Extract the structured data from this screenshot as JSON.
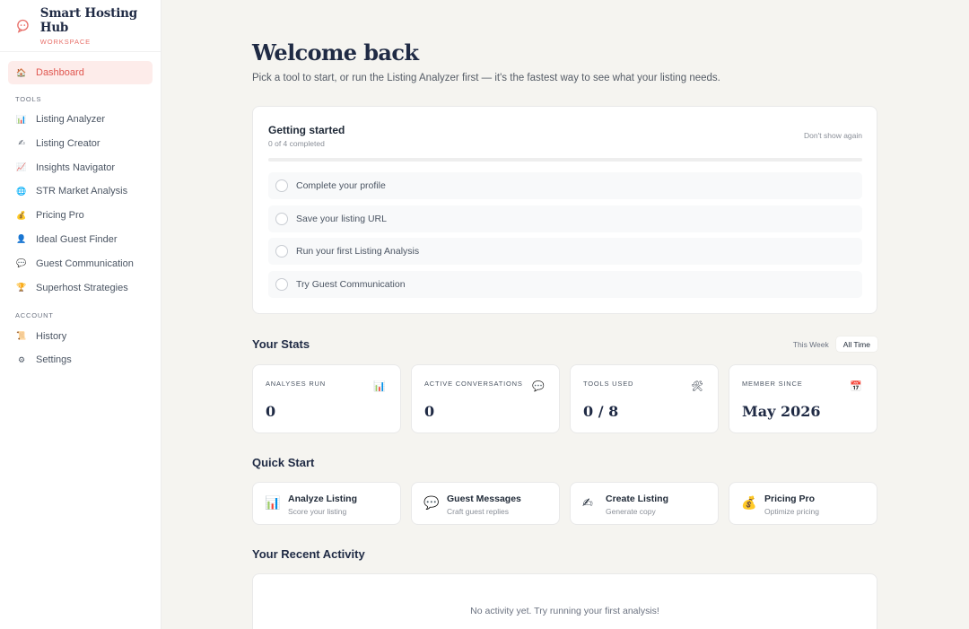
{
  "brand": {
    "name": "Smart Hosting Hub",
    "subtitle": "WORKSPACE",
    "accent": "#e0564f"
  },
  "sidebar": {
    "dashboard": {
      "label": "Dashboard",
      "icon": "house-icon"
    },
    "tools_heading": "TOOLS",
    "tools": [
      {
        "label": "Listing Analyzer",
        "icon": "bar-chart-icon"
      },
      {
        "label": "Listing Creator",
        "icon": "writing-hand-icon"
      },
      {
        "label": "Insights Navigator",
        "icon": "trend-chart-icon"
      },
      {
        "label": "STR Market Analysis",
        "icon": "globe-icon"
      },
      {
        "label": "Pricing Pro",
        "icon": "money-bag-icon"
      },
      {
        "label": "Ideal Guest Finder",
        "icon": "person-icon"
      },
      {
        "label": "Guest Communication",
        "icon": "speech-bubble-icon"
      },
      {
        "label": "Superhost Strategies",
        "icon": "trophy-icon"
      }
    ],
    "account_heading": "ACCOUNT",
    "account": [
      {
        "label": "History",
        "icon": "history-icon"
      },
      {
        "label": "Settings",
        "icon": "gear-icon"
      }
    ]
  },
  "welcome": {
    "title": "Welcome back",
    "subtitle": "Pick a tool to start, or run the Listing Analyzer first — it's the fastest way to see what your listing needs."
  },
  "getting_started": {
    "title": "Getting started",
    "count": "0 of 4 completed",
    "progress": 0,
    "dismiss": "Don't show again",
    "items": [
      "Complete your profile",
      "Save your listing URL",
      "Run your first Listing Analysis",
      "Try Guest Communication"
    ]
  },
  "stats": {
    "title": "Your Stats",
    "toggle": [
      "This Week",
      "All Time"
    ],
    "active_toggle": "All Time",
    "cards": [
      {
        "label": "ANALYSES RUN",
        "value": "0",
        "icon": "bar-chart-icon"
      },
      {
        "label": "ACTIVE CONVERSATIONS",
        "value": "0",
        "icon": "speech-bubble-icon"
      },
      {
        "label": "TOOLS USED",
        "value": "0 / 8",
        "icon": "tools-icon"
      },
      {
        "label": "MEMBER SINCE",
        "value": "May 2026",
        "icon": "calendar-icon"
      }
    ]
  },
  "quick_start": {
    "title": "Quick Start",
    "cards": [
      {
        "title": "Analyze Listing",
        "sub": "Score your listing",
        "icon": "bar-chart-icon"
      },
      {
        "title": "Guest Messages",
        "sub": "Craft guest replies",
        "icon": "speech-bubble-icon"
      },
      {
        "title": "Create Listing",
        "sub": "Generate copy",
        "icon": "writing-hand-icon"
      },
      {
        "title": "Pricing Pro",
        "sub": "Optimize pricing",
        "icon": "money-bag-icon"
      }
    ]
  },
  "activity": {
    "title": "Your Recent Activity",
    "empty": "No activity yet. Try running your first analysis!"
  }
}
